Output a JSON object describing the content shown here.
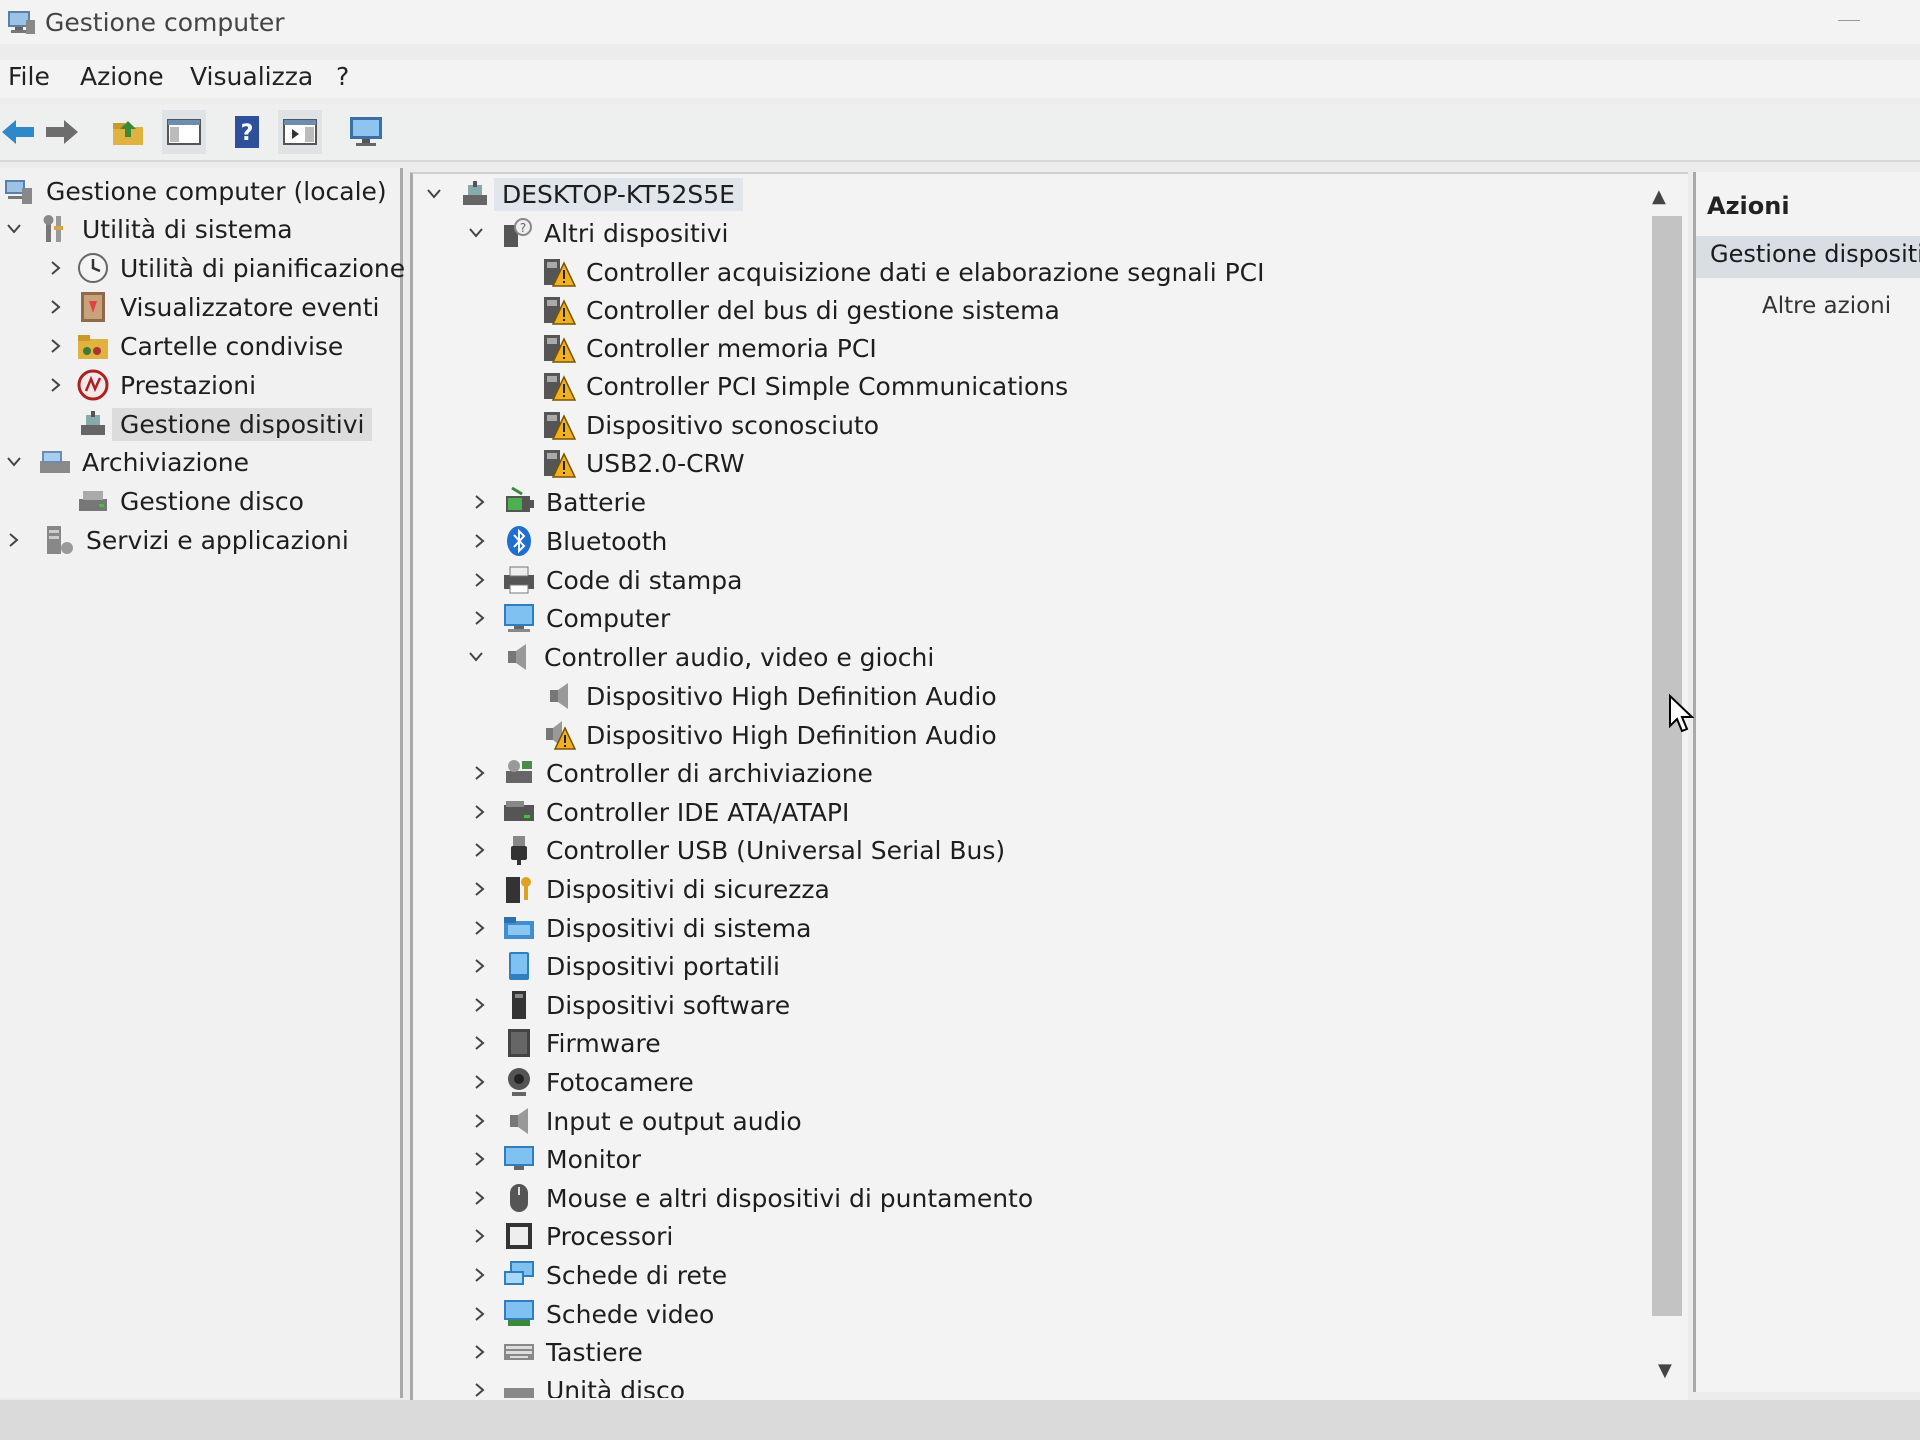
{
  "window": {
    "title": "Gestione computer"
  },
  "menu": [
    "File",
    "Azione",
    "Visualizza",
    "?"
  ],
  "toolbar": [
    "back-icon",
    "forward-icon",
    "up-folder-icon",
    "show-hide-console-tree-icon",
    "help-icon",
    "show-hide-action-pane-icon",
    "computer-monitor-icon"
  ],
  "left_tree": {
    "root": "Gestione computer (locale)",
    "system_tools": "Utilità di sistema",
    "task_scheduler": "Utilità di pianificazione",
    "event_viewer": "Visualizzatore eventi",
    "shared_folders": "Cartelle condivise",
    "performance": "Prestazioni",
    "device_manager": "Gestione dispositivi",
    "storage": "Archiviazione",
    "disk_management": "Gestione disco",
    "services_apps": "Servizi e applicazioni"
  },
  "device_tree": {
    "root": "DESKTOP-KT52S5E",
    "other_devices": "Altri dispositivi",
    "other_children": [
      "Controller acquisizione dati e elaborazione segnali PCI",
      "Controller del bus di gestione sistema",
      "Controller memoria PCI",
      "Controller PCI Simple Communications",
      "Dispositivo sconosciuto",
      "USB2.0-CRW"
    ],
    "batteries": "Batterie",
    "bluetooth": "Bluetooth",
    "print_queues": "Code di stampa",
    "computer": "Computer",
    "audio_controllers": "Controller audio, video e giochi",
    "audio_children": [
      "Dispositivo High Definition Audio",
      "Dispositivo High Definition Audio"
    ],
    "storage_controllers": "Controller di archiviazione",
    "ide_controllers": "Controller IDE ATA/ATAPI",
    "usb_controllers": "Controller USB (Universal Serial Bus)",
    "security_devices": "Dispositivi di sicurezza",
    "system_devices": "Dispositivi di sistema",
    "portable_devices": "Dispositivi portatili",
    "software_devices": "Dispositivi software",
    "firmware": "Firmware",
    "cameras": "Fotocamere",
    "audio_io": "Input e output audio",
    "monitors": "Monitor",
    "mice": "Mouse e altri dispositivi di puntamento",
    "processors": "Processori",
    "network_adapters": "Schede di rete",
    "display_adapters": "Schede video",
    "keyboards": "Tastiere",
    "disk_drives": "Unità disco"
  },
  "actions": {
    "header": "Azioni",
    "selected": "Gestione dispositivi",
    "more": "Altre azioni"
  }
}
